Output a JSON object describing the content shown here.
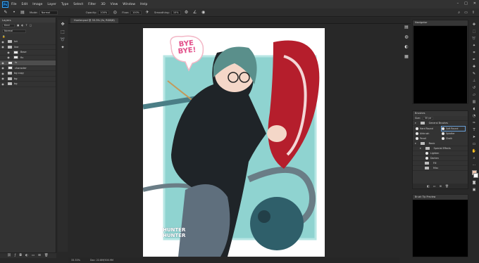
{
  "menubar": {
    "logo": "Ps",
    "items": [
      "File",
      "Edit",
      "Image",
      "Layer",
      "Type",
      "Select",
      "Filter",
      "3D",
      "View",
      "Window",
      "Help"
    ],
    "controls": [
      "–",
      "□",
      "✕"
    ]
  },
  "options": {
    "mode_label": "Mode:",
    "mode_value": "Normal",
    "opacity_label": "Opacity:",
    "opacity_value": "100%",
    "flow_label": "Flow:",
    "flow_value": "100%",
    "smoothing_label": "Smoothing:",
    "smoothing_value": "10%"
  },
  "layers": {
    "title": "Layers",
    "kind_label": "Kind",
    "blend_mode": "Normal",
    "rows": [
      {
        "name": "txt",
        "type": "folder",
        "selected": false
      },
      {
        "name": "line",
        "type": "folder",
        "selected": false
      },
      {
        "name": "Base",
        "type": "layer",
        "selected": false
      },
      {
        "name": "fix",
        "type": "layer",
        "selected": false
      },
      {
        "name": "fx",
        "type": "layer",
        "selected": true
      },
      {
        "name": "character",
        "type": "layer",
        "selected": false
      },
      {
        "name": "bg copy",
        "type": "folder",
        "selected": false
      },
      {
        "name": "bg",
        "type": "folder",
        "selected": false
      },
      {
        "name": "bg",
        "type": "folder",
        "selected": false
      }
    ],
    "footer_icons": [
      "link-icon",
      "fx-icon",
      "mask-icon",
      "adjustment-icon",
      "folder-icon",
      "new-layer-icon",
      "trash-icon"
    ]
  },
  "document": {
    "tab_label": "Hunter.psd @ 33.3% (fx, RGB/8)",
    "bye_text": "BYE BYE!",
    "signature": "HUNTER\nHUNTER"
  },
  "statusbar": {
    "zoom": "33.33%",
    "doc_size": "Doc: 22.8M/500.9M"
  },
  "navigator": {
    "title": "Navigator"
  },
  "brushes": {
    "title": "Brushes",
    "size_label": "Size:",
    "size_value": "30 px",
    "groups": [
      "General Brushes",
      "Dry Media Brushes"
    ],
    "items": [
      "Hard Round",
      "Soft Round",
      "Airbrush",
      "Splatter",
      "Pencil",
      "Chalk"
    ],
    "folders": [
      "Basic",
      "Special Effects"
    ],
    "subfolders": [
      "Lighten",
      "Darken",
      "Fill"
    ],
    "last_label": "Misc"
  },
  "bottom_panel": {
    "title": "Brush Tip Preview"
  }
}
